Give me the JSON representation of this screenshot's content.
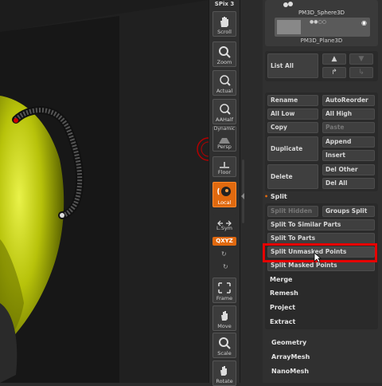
{
  "toolbar": {
    "spix": "SPix 3",
    "buttons": [
      {
        "label": "Scroll",
        "icon": "scroll-hand-icon"
      },
      {
        "label": "Zoom",
        "icon": "zoom-magnifier-icon"
      },
      {
        "label": "Actual",
        "icon": "actual-size-icon"
      },
      {
        "label": "AAHalf",
        "icon": "aahalf-icon"
      },
      {
        "label": "Persp",
        "top_label": "Dynamic",
        "icon": "perspective-icon"
      },
      {
        "label": "Floor",
        "icon": "floor-grid-icon"
      },
      {
        "label": "Local",
        "icon": "local-sphere-icon",
        "active": true
      },
      {
        "label": "L.Sym",
        "icon": "local-symmetry-icon"
      },
      {
        "label": "Frame",
        "icon": "frame-icon"
      },
      {
        "label": "Move",
        "icon": "move-icon"
      },
      {
        "label": "Scale",
        "icon": "scale-icon"
      },
      {
        "label": "Rotate",
        "icon": "rotate-icon"
      }
    ],
    "xyz": "QXYZ"
  },
  "subtool": {
    "item1": "PM3D_Sphere3D",
    "item2": "PM3D_Plane3D"
  },
  "list_all": "List All",
  "buttons": {
    "rename": "Rename",
    "autoreorder": "AutoReorder",
    "all_low": "All Low",
    "all_high": "All High",
    "copy": "Copy",
    "paste": "Paste",
    "duplicate": "Duplicate",
    "append": "Append",
    "insert": "Insert",
    "delete": "Delete",
    "del_other": "Del Other",
    "del_all": "Del All"
  },
  "split": {
    "title": "Split",
    "split_hidden": "Split Hidden",
    "groups_split": "Groups Split",
    "split_similar": "Split To Similar Parts",
    "split_parts": "Split To Parts",
    "split_unmasked": "Split Unmasked Points",
    "split_masked": "Split Masked Points"
  },
  "sections": {
    "merge": "Merge",
    "remesh": "Remesh",
    "project": "Project",
    "extract": "Extract",
    "geometry": "Geometry",
    "arraymesh": "ArrayMesh",
    "nanomesh": "NanoMesh"
  },
  "colors": {
    "accent": "#e0690f",
    "model": "#b8c40a",
    "highlight": "#e60000"
  }
}
